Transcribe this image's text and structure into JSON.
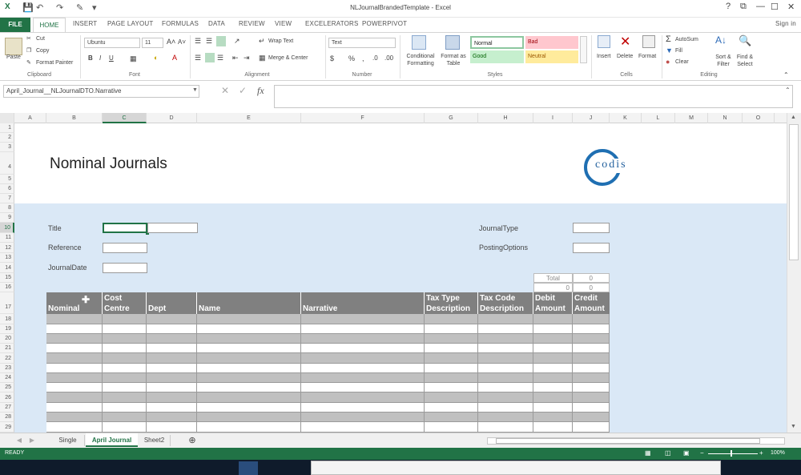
{
  "window": {
    "title": "NLJournalBrandedTemplate - Excel",
    "controls": [
      "?",
      "⧉",
      "—",
      "☐",
      "✕"
    ],
    "signin": "Sign in"
  },
  "ribbon_tabs": [
    "FILE",
    "HOME",
    "INSERT",
    "PAGE LAYOUT",
    "FORMULAS",
    "DATA",
    "REVIEW",
    "VIEW",
    "EXCELERATORS",
    "POWERPIVOT"
  ],
  "ribbon": {
    "clipboard": {
      "paste": "Paste",
      "cut": "Cut",
      "copy": "Copy",
      "format_painter": "Format Painter",
      "label": "Clipboard"
    },
    "font": {
      "name": "Ubuntu",
      "size": "11",
      "label": "Font"
    },
    "alignment": {
      "wrap": "Wrap Text",
      "merge": "Merge & Center",
      "label": "Alignment"
    },
    "number": {
      "format": "Text",
      "label": "Number"
    },
    "styles": {
      "conditional": "Conditional Formatting",
      "format_table": "Format as Table",
      "normal": "Normal",
      "bad": "Bad",
      "good": "Good",
      "neutral": "Neutral",
      "label": "Styles"
    },
    "cells": {
      "insert": "Insert",
      "delete": "Delete",
      "format": "Format",
      "label": "Cells"
    },
    "editing": {
      "autosum": "AutoSum",
      "fill": "Fill",
      "clear": "Clear",
      "sort": "Sort & Filter",
      "find": "Find & Select",
      "label": "Editing"
    }
  },
  "formula_bar": {
    "name_box": "April_Journal__NLJournalDTO.Narrative",
    "fx": "fx",
    "value": ""
  },
  "columns": [
    "A",
    "B",
    "C",
    "D",
    "E",
    "F",
    "G",
    "H",
    "I",
    "J",
    "K",
    "L",
    "M",
    "N",
    "O"
  ],
  "rows": [
    "1",
    "2",
    "3",
    "4",
    "5",
    "6",
    "7",
    "8",
    "9",
    "10",
    "11",
    "12",
    "13",
    "14",
    "15",
    "16",
    "17",
    "18",
    "19",
    "20",
    "21",
    "22",
    "23",
    "24",
    "25",
    "26",
    "27",
    "28",
    "29"
  ],
  "sheet": {
    "heading": "Nominal Journals",
    "logo_text": "codis",
    "fields": {
      "title": "Title",
      "reference": "Reference",
      "journal_date": "JournalDate",
      "journal_type": "JournalType",
      "posting_options": "PostingOptions"
    },
    "totals": {
      "total_label": "Total",
      "total_value": "0",
      "row16_left": "0",
      "row16_right": "0"
    },
    "table_headers": [
      "Nominal",
      "Cost Centre",
      "Dept",
      "Name",
      "Narrative",
      "Tax Type Description",
      "Tax Code Description",
      "Debit Amount",
      "Credit Amount"
    ]
  },
  "sheet_tabs": [
    "Single",
    "April Journal",
    "Sheet2"
  ],
  "active_sheet": "April Journal",
  "status": {
    "ready": "READY",
    "zoom": "100%"
  },
  "colors": {
    "excel_green": "#217346",
    "sheet_blue": "#dae8f6",
    "header_gray": "#808080"
  }
}
